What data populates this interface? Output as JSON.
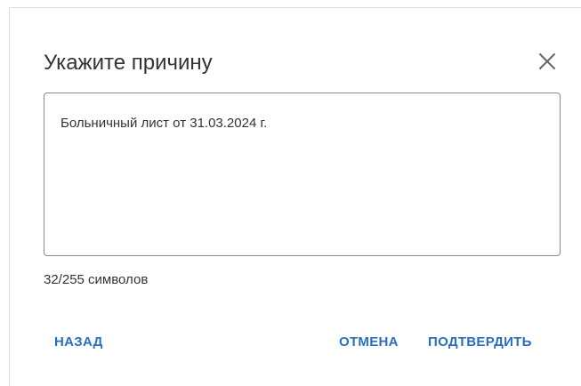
{
  "dialog": {
    "title": "Укажите причину",
    "close_icon": "close-icon",
    "reason_value": "Больничный лист от 31.03.2024 г.",
    "counter": "32/255 символов",
    "buttons": {
      "back": "НАЗАД",
      "cancel": "ОТМЕНА",
      "confirm": "ПОДТВЕРДИТЬ"
    }
  },
  "colors": {
    "accent": "#2a6fbf",
    "text": "#333333",
    "border": "#8a8a8a"
  }
}
